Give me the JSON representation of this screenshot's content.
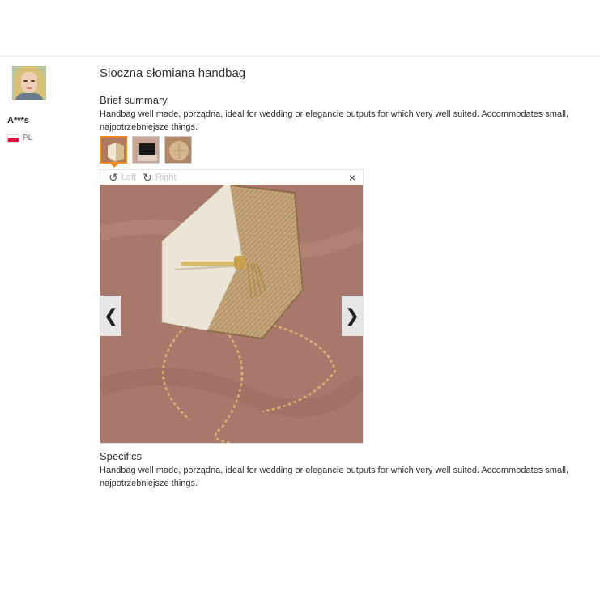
{
  "reviewer": {
    "name": "A***s",
    "country": "PL"
  },
  "product": {
    "title": "Sloczna słomiana handbag"
  },
  "brief": {
    "heading": "Brief summary",
    "text": "Handbag well made, porządna, ideal for wedding or elegancie outputs for which very well suited. Accommodates small, najpotrzebniejsze things."
  },
  "thumbnails": [
    "photo-1",
    "photo-2",
    "photo-3"
  ],
  "viewer": {
    "rotate_left": "Left",
    "rotate_right": "Right",
    "close": "×",
    "prev": "❮",
    "next": "❯"
  },
  "specifics": {
    "heading": "Specifics",
    "text": "Handbag well made, porządna, ideal for wedding or elegancie outputs for which very well suited. Accommodates small, najpotrzebniejsze things."
  },
  "colors": {
    "accent": "#f08a24",
    "photo_bg": "#a8786c",
    "bag_cream": "#ece4d6",
    "bag_straw": "#c9a97c"
  }
}
